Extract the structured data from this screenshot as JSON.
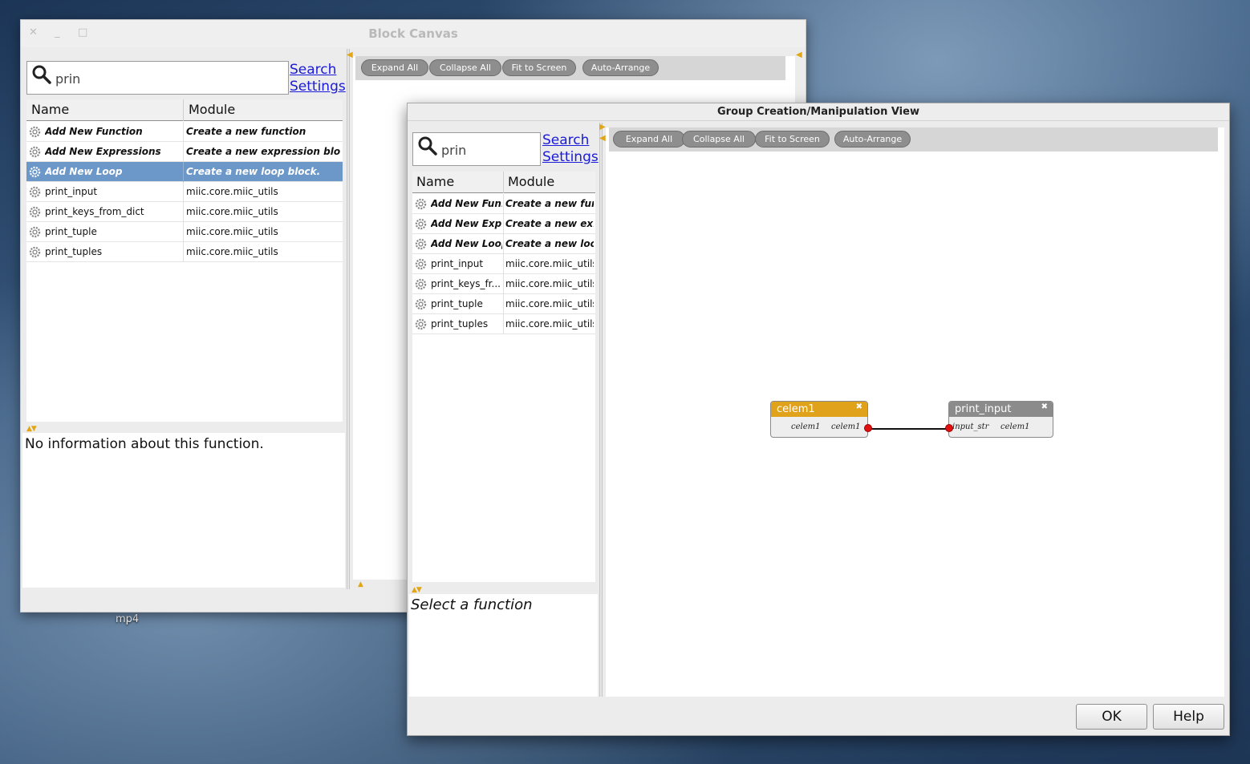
{
  "desktop": {
    "file_label": "mp4"
  },
  "block_canvas": {
    "title": "Block Canvas",
    "controls": {
      "close": "✕",
      "minimize": "_",
      "maximize": "□"
    },
    "search": {
      "value": "prin",
      "link_search": "Search",
      "link_settings": "Settings"
    },
    "columns": {
      "name": "Name",
      "module": "Module"
    },
    "rows": [
      {
        "name": "Add New Function",
        "module": "Create a new function"
      },
      {
        "name": "Add New Expressions",
        "module": "Create a new expression block"
      },
      {
        "name": "Add New Loop",
        "module": "Create a new loop block."
      },
      {
        "name": "print_input",
        "module": "miic.core.miic_utils"
      },
      {
        "name": "print_keys_from_dict",
        "module": "miic.core.miic_utils"
      },
      {
        "name": "print_tuple",
        "module": "miic.core.miic_utils"
      },
      {
        "name": "print_tuples",
        "module": "miic.core.miic_utils"
      }
    ],
    "info_text": "No information about this function.",
    "toolbar": {
      "expand_all": "Expand All",
      "collapse_all": "Collapse All",
      "fit_to_screen": "Fit to Screen",
      "auto_arrange": "Auto-Arrange"
    }
  },
  "group_view": {
    "title": "Group Creation/Manipulation View",
    "search": {
      "value": "prin",
      "link_search": "Search",
      "link_settings": "Settings"
    },
    "columns": {
      "name": "Name",
      "module": "Module"
    },
    "rows": [
      {
        "name": "Add New Fun...",
        "module": "Create a new fun..."
      },
      {
        "name": "Add New Exp...",
        "module": "Create a new ex..."
      },
      {
        "name": "Add New Loop",
        "module": "Create a new loo..."
      },
      {
        "name": "print_input",
        "module": "miic.core.miic_utils"
      },
      {
        "name": "print_keys_fr...",
        "module": "miic.core.miic_utils"
      },
      {
        "name": "print_tuple",
        "module": "miic.core.miic_utils"
      },
      {
        "name": "print_tuples",
        "module": "miic.core.miic_utils"
      }
    ],
    "info_text": "Select a function",
    "toolbar": {
      "expand_all": "Expand All",
      "collapse_all": "Collapse All",
      "fit_to_screen": "Fit to Screen",
      "auto_arrange": "Auto-Arrange"
    },
    "nodes": [
      {
        "title": "celem1",
        "color": "#e0a21a",
        "in_port": "celem1",
        "out_port": "celem1"
      },
      {
        "title": "print_input",
        "color": "#8b8b8b",
        "in_port": "input_str",
        "out_port": "celem1"
      }
    ],
    "buttons": {
      "ok": "OK",
      "help": "Help"
    }
  },
  "colors": {
    "selection": "#6c97c9",
    "accent_arrow": "#e2a615",
    "port": "#e01010"
  }
}
